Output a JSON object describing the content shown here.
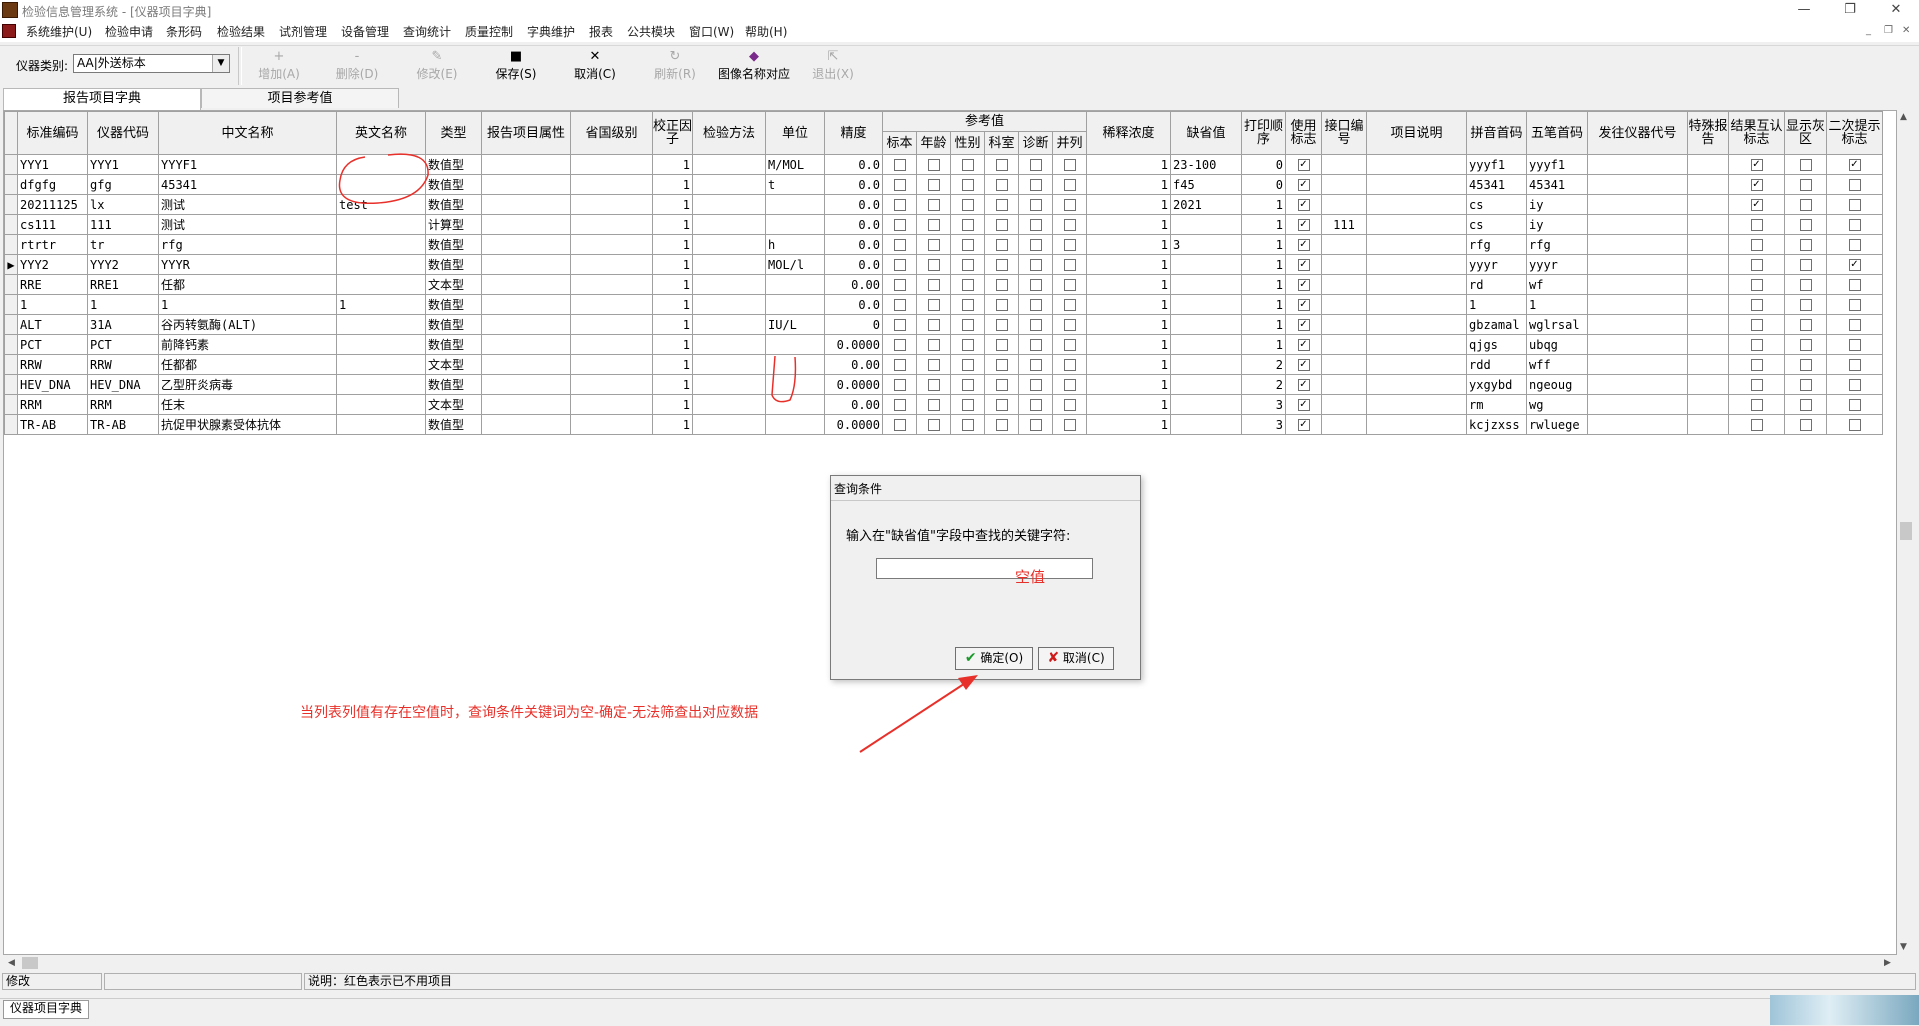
{
  "window": {
    "title": "检验信息管理系统 - [仪器项目字典]",
    "minimize_glyph": "—",
    "restore_glyph": "❐",
    "close_glyph": "✕"
  },
  "menu": [
    "系统维护(U)",
    "检验申请",
    "条形码",
    "检验结果",
    "试剂管理",
    "设备管理",
    "查询统计",
    "质量控制",
    "字典维护",
    "报表",
    "公共模块",
    "窗口(W)",
    "帮助(H)"
  ],
  "mdi_controls": {
    "minimize": "_",
    "restore": "❐",
    "close": "✕"
  },
  "toolbar": {
    "category_label": "仪器类别:",
    "category_value": "AA|外送标本",
    "dropdown_arrow": "▼",
    "buttons": [
      {
        "label": "增加(A)",
        "icon": "+",
        "enabled": false
      },
      {
        "label": "删除(D)",
        "icon": "-",
        "enabled": false
      },
      {
        "label": "修改(E)",
        "icon": "✎",
        "enabled": false
      },
      {
        "label": "保存(S)",
        "icon": "■",
        "enabled": true
      },
      {
        "label": "取消(C)",
        "icon": "✕",
        "enabled": true
      },
      {
        "label": "刷新(R)",
        "icon": "↻",
        "enabled": false
      },
      {
        "label": "图像名称对应",
        "icon": "◆",
        "enabled": true
      },
      {
        "label": "退出(X)",
        "icon": "⇱",
        "enabled": false
      }
    ]
  },
  "tabs": [
    {
      "label": "报告项目字典",
      "active": true
    },
    {
      "label": "项目参考值",
      "active": false
    }
  ],
  "grid": {
    "headers": [
      "标准编码",
      "仪器代码",
      "中文名称",
      "英文名称",
      "类型",
      "报告项目属性",
      "省国级别",
      "校正因子",
      "检验方法",
      "单位",
      "精度",
      "参考值",
      "稀释浓度",
      "缺省值",
      "打印顺序",
      "使用标志",
      "接口编号",
      "项目说明",
      "拼音首码",
      "五笔首码",
      "发往仪器代号",
      "特殊报告",
      "结果互认标志",
      "显示灰区",
      "二次提示标志"
    ],
    "ref_subheaders": [
      "标本",
      "年龄",
      "性别",
      "科室",
      "诊断",
      "并列"
    ],
    "rows": [
      {
        "code": "YYY1",
        "inst": "YYY1",
        "cn": "YYYF1",
        "en": "",
        "type": "数值型",
        "factor": "1",
        "unit": "M/MOL",
        "precision": "0.0",
        "dilution": "1",
        "default": "23-100",
        "order": "0",
        "used": true,
        "iface": "",
        "py": "yyyf1",
        "wb": "yyyf1",
        "mutual": true,
        "gray": false,
        "second": true,
        "current": false
      },
      {
        "code": "dfgfg",
        "inst": "gfg",
        "cn": "45341",
        "en": "",
        "type": "数值型",
        "factor": "1",
        "unit": "t",
        "precision": "0.0",
        "dilution": "1",
        "default": "f45",
        "order": "0",
        "used": true,
        "iface": "",
        "py": "45341",
        "wb": "45341",
        "mutual": true,
        "gray": false,
        "second": false,
        "current": false
      },
      {
        "code": "20211125",
        "inst": "lx",
        "cn": "测试",
        "en": "test",
        "type": "数值型",
        "factor": "1",
        "unit": "",
        "precision": "0.0",
        "dilution": "1",
        "default": "2021",
        "order": "1",
        "used": true,
        "iface": "",
        "py": "cs",
        "wb": "iy",
        "mutual": true,
        "gray": false,
        "second": false,
        "current": false
      },
      {
        "code": "cs111",
        "inst": "111",
        "cn": "测试",
        "en": "",
        "type": "计算型",
        "factor": "1",
        "unit": "",
        "precision": "0.0",
        "dilution": "1",
        "default": "",
        "order": "1",
        "used": true,
        "iface": "111",
        "py": "cs",
        "wb": "iy",
        "mutual": false,
        "gray": false,
        "second": false,
        "current": false
      },
      {
        "code": "rtrtr",
        "inst": "tr",
        "cn": "rfg",
        "en": "",
        "type": "数值型",
        "factor": "1",
        "unit": "h",
        "precision": "0.0",
        "dilution": "1",
        "default": "3",
        "order": "1",
        "used": true,
        "iface": "",
        "py": "rfg",
        "wb": "rfg",
        "mutual": false,
        "gray": false,
        "second": false,
        "current": false
      },
      {
        "code": "YYY2",
        "inst": "YYY2",
        "cn": "YYYR",
        "en": "",
        "type": "数值型",
        "factor": "1",
        "unit": "MOL/l",
        "precision": "0.0",
        "dilution": "1",
        "default": "",
        "order": "1",
        "used": true,
        "iface": "",
        "py": "yyyr",
        "wb": "yyyr",
        "mutual": false,
        "gray": false,
        "second": true,
        "current": true
      },
      {
        "code": "RRE",
        "inst": "RRE1",
        "cn": "任都",
        "en": "",
        "type": "文本型",
        "factor": "1",
        "unit": "",
        "precision": "0.00",
        "dilution": "1",
        "default": "",
        "order": "1",
        "used": true,
        "iface": "",
        "py": "rd",
        "wb": "wf",
        "mutual": false,
        "gray": false,
        "second": false,
        "current": false
      },
      {
        "code": "1",
        "inst": "1",
        "cn": "1",
        "en": "1",
        "type": "数值型",
        "factor": "1",
        "unit": "",
        "precision": "0.0",
        "dilution": "1",
        "default": "",
        "order": "1",
        "used": true,
        "iface": "",
        "py": "1",
        "wb": "1",
        "mutual": false,
        "gray": false,
        "second": false,
        "current": false
      },
      {
        "code": "ALT",
        "inst": "31A",
        "cn": "谷丙转氨酶(ALT)",
        "en": "",
        "type": "数值型",
        "factor": "1",
        "unit": "IU/L",
        "precision": "0",
        "dilution": "1",
        "default": "",
        "order": "1",
        "used": true,
        "iface": "",
        "py": "gbzamal",
        "wb": "wglrsal",
        "mutual": false,
        "gray": false,
        "second": false,
        "current": false
      },
      {
        "code": "PCT",
        "inst": "PCT",
        "cn": "前降钙素",
        "en": "",
        "type": "数值型",
        "factor": "1",
        "unit": "",
        "precision": "0.0000",
        "dilution": "1",
        "default": "",
        "order": "1",
        "used": true,
        "iface": "",
        "py": "qjgs",
        "wb": "ubqg",
        "mutual": false,
        "gray": false,
        "second": false,
        "current": false
      },
      {
        "code": "RRW",
        "inst": "RRW",
        "cn": "任都都",
        "en": "",
        "type": "文本型",
        "factor": "1",
        "unit": "",
        "precision": "0.00",
        "dilution": "1",
        "default": "",
        "order": "2",
        "used": true,
        "iface": "",
        "py": "rdd",
        "wb": "wff",
        "mutual": false,
        "gray": false,
        "second": false,
        "current": false
      },
      {
        "code": "HEV_DNA",
        "inst": "HEV_DNA",
        "cn": "乙型肝炎病毒",
        "en": "",
        "type": "数值型",
        "factor": "1",
        "unit": "",
        "precision": "0.0000",
        "dilution": "1",
        "default": "",
        "order": "2",
        "used": true,
        "iface": "",
        "py": "yxgybd",
        "wb": "ngeoug",
        "mutual": false,
        "gray": false,
        "second": false,
        "current": false
      },
      {
        "code": "RRM",
        "inst": "RRM",
        "cn": "任末",
        "en": "",
        "type": "文本型",
        "factor": "1",
        "unit": "",
        "precision": "0.00",
        "dilution": "1",
        "default": "",
        "order": "3",
        "used": true,
        "iface": "",
        "py": "rm",
        "wb": "wg",
        "mutual": false,
        "gray": false,
        "second": false,
        "current": false
      },
      {
        "code": "TR-AB",
        "inst": "TR-AB",
        "cn": "抗促甲状腺素受体抗体",
        "en": "",
        "type": "数值型",
        "factor": "1",
        "unit": "",
        "precision": "0.0000",
        "dilution": "1",
        "default": "",
        "order": "3",
        "used": true,
        "iface": "",
        "py": "kcjzxss",
        "wb": "rwluege",
        "mutual": false,
        "gray": false,
        "second": false,
        "current": false
      }
    ]
  },
  "statusbar": {
    "mode": "修改",
    "field2": "",
    "note": "说明：红色表示已不用项目"
  },
  "taskbar": {
    "item": "仪器项目字典"
  },
  "dialog": {
    "title": "查询条件",
    "prompt": "输入在\"缺省值\"字段中查找的关键字符:",
    "input_value": "",
    "ok_label": "确定(O)",
    "ok_icon": "✔",
    "cancel_label": "取消(C)",
    "cancel_icon": "✘"
  },
  "annotations": {
    "empty_value": "空值",
    "description": "当列表列值有存在空值时，查询条件关键词为空-确定-无法筛查出对应数据",
    "color": "#e8302a"
  },
  "scroll_arrows": {
    "up": "▲",
    "down": "▼",
    "left": "◀",
    "right": "▶",
    "row_marker": "▶",
    "check": "✓"
  }
}
